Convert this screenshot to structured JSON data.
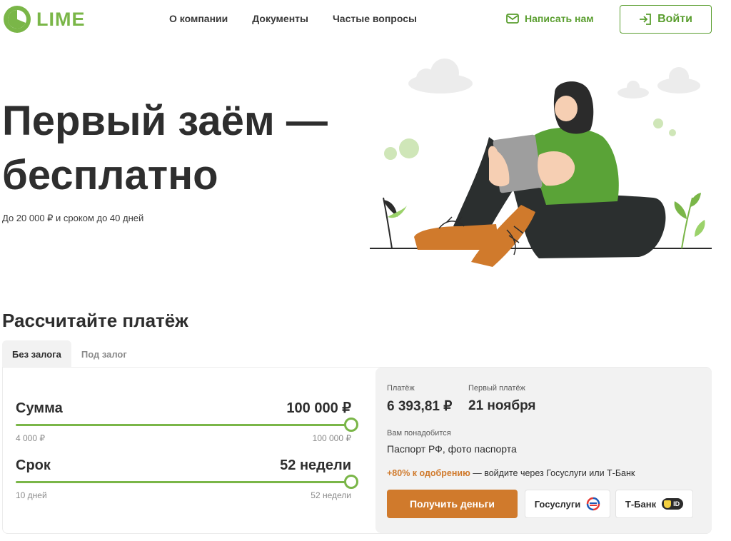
{
  "header": {
    "logo_text": "LIME",
    "nav": [
      "О компании",
      "Документы",
      "Частые вопросы"
    ],
    "write_us": "Написать нам",
    "login": "Войти"
  },
  "hero": {
    "title_line1": "Первый заём —",
    "title_line2": "бесплатно",
    "subtitle": "До 20 000 ₽ и сроком до 40 дней"
  },
  "calculator": {
    "title": "Рассчитайте платёж",
    "tabs": [
      {
        "label": "Без залога",
        "active": true
      },
      {
        "label": "Под залог",
        "active": false
      }
    ],
    "amount": {
      "label": "Сумма",
      "value": "100 000 ₽",
      "min": "4 000 ₽",
      "max": "100 000 ₽",
      "fraction": 1.0
    },
    "term": {
      "label": "Срок",
      "value": "52 недели",
      "min": "10 дней",
      "max": "52 недели",
      "fraction": 1.0
    },
    "summary": {
      "payment_label": "Платёж",
      "payment_value": "6 393,81 ₽",
      "first_payment_label": "Первый платёж",
      "first_payment_value": "21 ноября",
      "docs_label": "Вам понадобится",
      "docs_value": "Паспорт РФ, фото паспорта",
      "approval_accent": "+80% к одобрению",
      "approval_text": " — войдите через Госуслуги или Т-Банк"
    },
    "get_money": "Получить деньги",
    "gosuslugi": "Госуслуги",
    "tbank": "Т-Банк",
    "tbank_badge": "ID"
  },
  "colors": {
    "brand_green": "#7ab648",
    "accent_orange": "#d07a2c"
  }
}
